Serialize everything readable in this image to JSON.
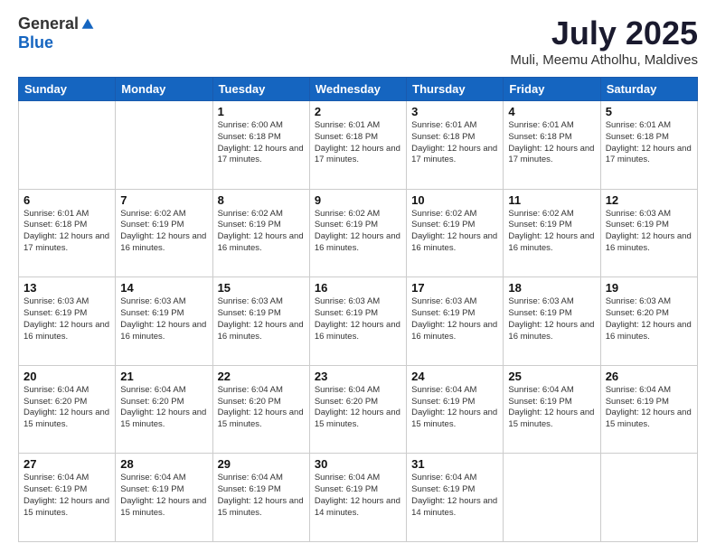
{
  "header": {
    "logo_general": "General",
    "logo_blue": "Blue",
    "title": "July 2025",
    "location": "Muli, Meemu Atholhu, Maldives"
  },
  "days_of_week": [
    "Sunday",
    "Monday",
    "Tuesday",
    "Wednesday",
    "Thursday",
    "Friday",
    "Saturday"
  ],
  "weeks": [
    [
      {
        "day": "",
        "info": ""
      },
      {
        "day": "",
        "info": ""
      },
      {
        "day": "1",
        "info": "Sunrise: 6:00 AM\nSunset: 6:18 PM\nDaylight: 12 hours and 17 minutes."
      },
      {
        "day": "2",
        "info": "Sunrise: 6:01 AM\nSunset: 6:18 PM\nDaylight: 12 hours and 17 minutes."
      },
      {
        "day": "3",
        "info": "Sunrise: 6:01 AM\nSunset: 6:18 PM\nDaylight: 12 hours and 17 minutes."
      },
      {
        "day": "4",
        "info": "Sunrise: 6:01 AM\nSunset: 6:18 PM\nDaylight: 12 hours and 17 minutes."
      },
      {
        "day": "5",
        "info": "Sunrise: 6:01 AM\nSunset: 6:18 PM\nDaylight: 12 hours and 17 minutes."
      }
    ],
    [
      {
        "day": "6",
        "info": "Sunrise: 6:01 AM\nSunset: 6:18 PM\nDaylight: 12 hours and 17 minutes."
      },
      {
        "day": "7",
        "info": "Sunrise: 6:02 AM\nSunset: 6:19 PM\nDaylight: 12 hours and 16 minutes."
      },
      {
        "day": "8",
        "info": "Sunrise: 6:02 AM\nSunset: 6:19 PM\nDaylight: 12 hours and 16 minutes."
      },
      {
        "day": "9",
        "info": "Sunrise: 6:02 AM\nSunset: 6:19 PM\nDaylight: 12 hours and 16 minutes."
      },
      {
        "day": "10",
        "info": "Sunrise: 6:02 AM\nSunset: 6:19 PM\nDaylight: 12 hours and 16 minutes."
      },
      {
        "day": "11",
        "info": "Sunrise: 6:02 AM\nSunset: 6:19 PM\nDaylight: 12 hours and 16 minutes."
      },
      {
        "day": "12",
        "info": "Sunrise: 6:03 AM\nSunset: 6:19 PM\nDaylight: 12 hours and 16 minutes."
      }
    ],
    [
      {
        "day": "13",
        "info": "Sunrise: 6:03 AM\nSunset: 6:19 PM\nDaylight: 12 hours and 16 minutes."
      },
      {
        "day": "14",
        "info": "Sunrise: 6:03 AM\nSunset: 6:19 PM\nDaylight: 12 hours and 16 minutes."
      },
      {
        "day": "15",
        "info": "Sunrise: 6:03 AM\nSunset: 6:19 PM\nDaylight: 12 hours and 16 minutes."
      },
      {
        "day": "16",
        "info": "Sunrise: 6:03 AM\nSunset: 6:19 PM\nDaylight: 12 hours and 16 minutes."
      },
      {
        "day": "17",
        "info": "Sunrise: 6:03 AM\nSunset: 6:19 PM\nDaylight: 12 hours and 16 minutes."
      },
      {
        "day": "18",
        "info": "Sunrise: 6:03 AM\nSunset: 6:19 PM\nDaylight: 12 hours and 16 minutes."
      },
      {
        "day": "19",
        "info": "Sunrise: 6:03 AM\nSunset: 6:20 PM\nDaylight: 12 hours and 16 minutes."
      }
    ],
    [
      {
        "day": "20",
        "info": "Sunrise: 6:04 AM\nSunset: 6:20 PM\nDaylight: 12 hours and 15 minutes."
      },
      {
        "day": "21",
        "info": "Sunrise: 6:04 AM\nSunset: 6:20 PM\nDaylight: 12 hours and 15 minutes."
      },
      {
        "day": "22",
        "info": "Sunrise: 6:04 AM\nSunset: 6:20 PM\nDaylight: 12 hours and 15 minutes."
      },
      {
        "day": "23",
        "info": "Sunrise: 6:04 AM\nSunset: 6:20 PM\nDaylight: 12 hours and 15 minutes."
      },
      {
        "day": "24",
        "info": "Sunrise: 6:04 AM\nSunset: 6:19 PM\nDaylight: 12 hours and 15 minutes."
      },
      {
        "day": "25",
        "info": "Sunrise: 6:04 AM\nSunset: 6:19 PM\nDaylight: 12 hours and 15 minutes."
      },
      {
        "day": "26",
        "info": "Sunrise: 6:04 AM\nSunset: 6:19 PM\nDaylight: 12 hours and 15 minutes."
      }
    ],
    [
      {
        "day": "27",
        "info": "Sunrise: 6:04 AM\nSunset: 6:19 PM\nDaylight: 12 hours and 15 minutes."
      },
      {
        "day": "28",
        "info": "Sunrise: 6:04 AM\nSunset: 6:19 PM\nDaylight: 12 hours and 15 minutes."
      },
      {
        "day": "29",
        "info": "Sunrise: 6:04 AM\nSunset: 6:19 PM\nDaylight: 12 hours and 15 minutes."
      },
      {
        "day": "30",
        "info": "Sunrise: 6:04 AM\nSunset: 6:19 PM\nDaylight: 12 hours and 14 minutes."
      },
      {
        "day": "31",
        "info": "Sunrise: 6:04 AM\nSunset: 6:19 PM\nDaylight: 12 hours and 14 minutes."
      },
      {
        "day": "",
        "info": ""
      },
      {
        "day": "",
        "info": ""
      }
    ]
  ]
}
